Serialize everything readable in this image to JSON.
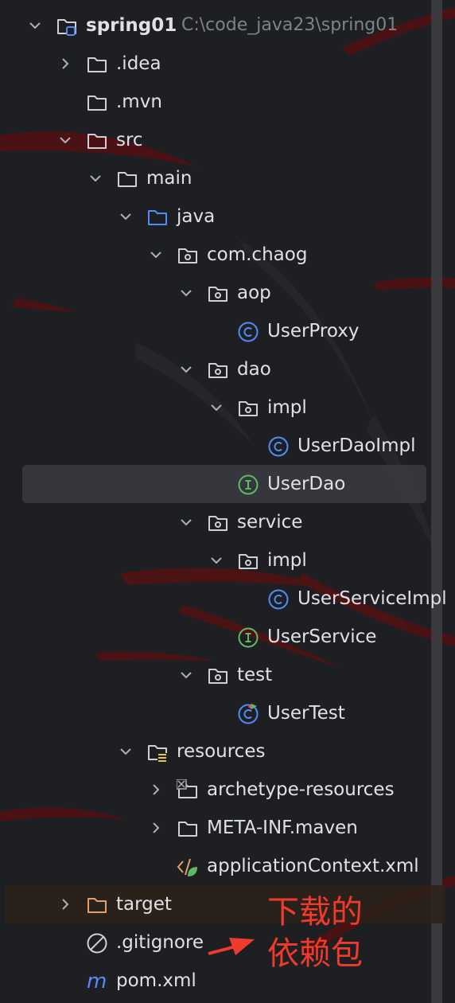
{
  "project": {
    "name": "spring01",
    "path": "C:\\code_java23\\spring01"
  },
  "tree": [
    {
      "label": ".idea",
      "icon": "folder-icon",
      "expanded": false
    },
    {
      "label": ".mvn",
      "icon": "folder-icon"
    },
    {
      "label": "src",
      "icon": "folder-icon",
      "expanded": true
    },
    {
      "label": "main",
      "icon": "folder-icon",
      "expanded": true
    },
    {
      "label": "java",
      "icon": "source-folder-icon",
      "expanded": true
    },
    {
      "label": "com.chaog",
      "icon": "package-icon",
      "expanded": true
    },
    {
      "label": "aop",
      "icon": "package-icon",
      "expanded": true
    },
    {
      "label": "UserProxy",
      "icon": "class-icon"
    },
    {
      "label": "dao",
      "icon": "package-icon",
      "expanded": true
    },
    {
      "label": "impl",
      "icon": "package-icon",
      "expanded": true
    },
    {
      "label": "UserDaoImpl",
      "icon": "class-icon"
    },
    {
      "label": "UserDao",
      "icon": "interface-icon",
      "selected": true
    },
    {
      "label": "service",
      "icon": "package-icon",
      "expanded": true
    },
    {
      "label": "impl",
      "icon": "package-icon",
      "expanded": true
    },
    {
      "label": "UserServiceImpl",
      "icon": "class-icon"
    },
    {
      "label": "UserService",
      "icon": "interface-icon"
    },
    {
      "label": "test",
      "icon": "package-icon",
      "expanded": true
    },
    {
      "label": "UserTest",
      "icon": "test-class-icon"
    },
    {
      "label": "resources",
      "icon": "resources-folder-icon",
      "expanded": true
    },
    {
      "label": "archetype-resources",
      "icon": "excluded-folder-icon",
      "expanded": false
    },
    {
      "label": "META-INF.maven",
      "icon": "folder-icon",
      "expanded": false
    },
    {
      "label": "applicationContext.xml",
      "icon": "xml-spring-icon"
    },
    {
      "label": "target",
      "icon": "excluded-folder-icon",
      "expanded": false
    },
    {
      "label": ".gitignore",
      "icon": "ignore-file-icon"
    },
    {
      "label": "pom.xml",
      "icon": "maven-icon"
    }
  ],
  "annotation": {
    "line1": "下载的",
    "line2": "依赖包",
    "color": "#f03a2b"
  },
  "colors": {
    "background": "#1e1f22",
    "text": "#dfe1e5",
    "folder": "#ced0d6",
    "source_folder": "#548af7",
    "class": "#548af7",
    "interface": "#5fb865",
    "target_folder": "#e0a06b",
    "selection": "#3a3c41"
  }
}
